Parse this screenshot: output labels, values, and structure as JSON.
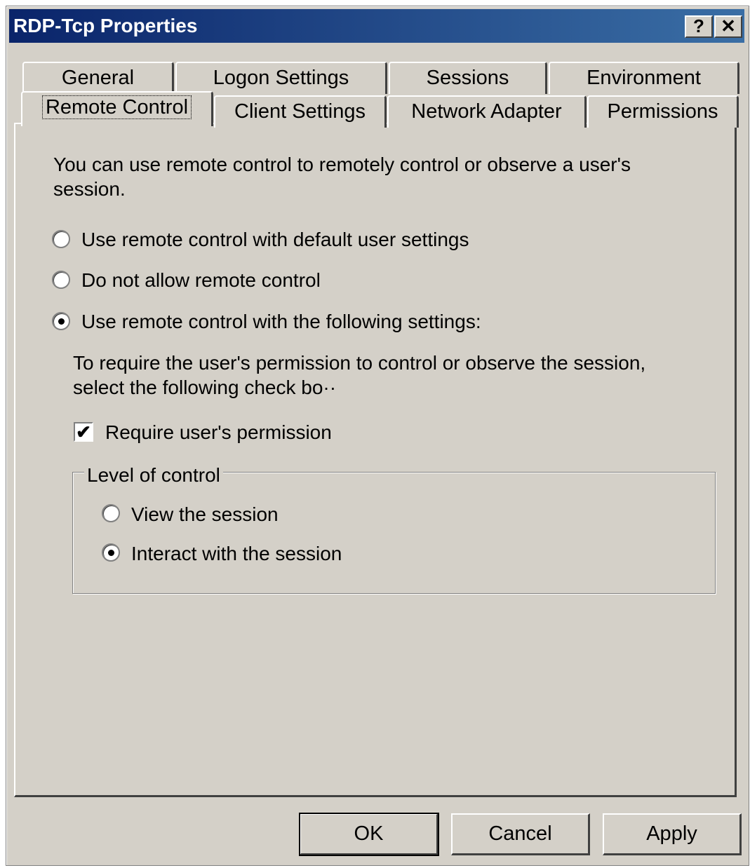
{
  "window": {
    "title": "RDP-Tcp Properties",
    "help_glyph": "?",
    "close_glyph": "✕"
  },
  "tabs": {
    "row1": [
      "General",
      "Logon Settings",
      "Sessions",
      "Environment"
    ],
    "row2": [
      "Remote Control",
      "Client Settings",
      "Network Adapter",
      "Permissions"
    ],
    "active": "Remote Control"
  },
  "content": {
    "intro": [
      "You can use remote control to remotely control or observe a user's",
      "session."
    ],
    "options": [
      {
        "label": "Use remote control with default user settings",
        "selected": false
      },
      {
        "label": "Do not allow remote control",
        "selected": false
      },
      {
        "label": "Use remote control with the following settings:",
        "selected": true
      }
    ],
    "permission_note": [
      "To require the user's permission to control or observe the session,",
      "select the following check bo··"
    ],
    "require_permission": {
      "label": "Require user's permission",
      "checked": true
    },
    "level_of_control": {
      "legend": "Level of control",
      "options": [
        {
          "label": "View the session",
          "selected": false
        },
        {
          "label": "Interact with the session",
          "selected": true
        }
      ]
    }
  },
  "buttons": {
    "ok": "OK",
    "cancel": "Cancel",
    "apply": "Apply"
  }
}
